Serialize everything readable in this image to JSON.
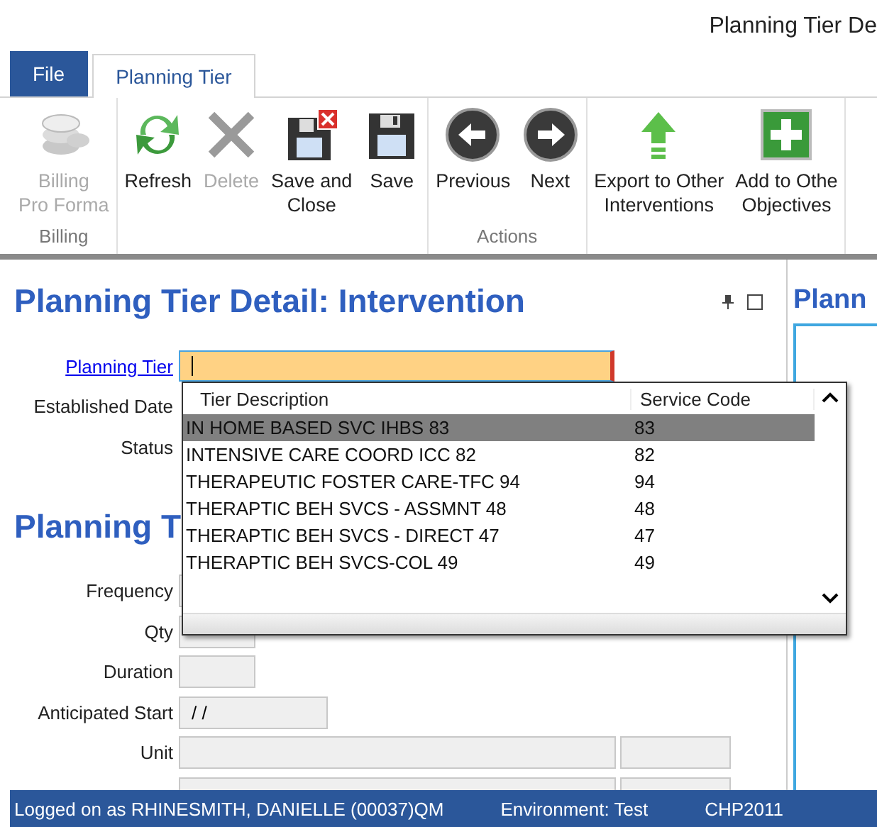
{
  "window": {
    "title": "Planning Tier De"
  },
  "tabs": [
    {
      "label": "File",
      "kind": "file",
      "selected": false
    },
    {
      "label": "Planning Tier",
      "kind": "tab",
      "selected": true
    }
  ],
  "ribbon": {
    "groups": [
      {
        "label": "Billing",
        "buttons": [
          {
            "lines": [
              "Billing",
              "Pro Forma"
            ],
            "kind": "coins",
            "disabled": true
          }
        ]
      },
      {
        "buttons": [
          {
            "lines": [
              "Refresh"
            ],
            "kind": "refresh",
            "disabled": false
          },
          {
            "lines": [
              "Delete"
            ],
            "kind": "delete",
            "disabled": true
          },
          {
            "lines": [
              "Save and",
              "Close"
            ],
            "kind": "save-close",
            "disabled": false
          },
          {
            "lines": [
              "Save"
            ],
            "kind": "save",
            "disabled": false
          }
        ]
      },
      {
        "label": "Actions",
        "buttons": [
          {
            "lines": [
              "Previous"
            ],
            "kind": "previous",
            "disabled": false
          },
          {
            "lines": [
              "Next"
            ],
            "kind": "next",
            "disabled": false
          }
        ]
      },
      {
        "buttons": [
          {
            "lines": [
              "Export to Other",
              "Interventions"
            ],
            "kind": "export",
            "disabled": false
          },
          {
            "lines": [
              "Add to Othe",
              "Objectives"
            ],
            "kind": "add",
            "disabled": false
          }
        ]
      }
    ]
  },
  "panel": {
    "title": "Planning Tier Detail: Intervention",
    "fields": [
      {
        "label": "Planning Tier",
        "kind": "lookup"
      },
      {
        "label": "Established Date",
        "kind": "label_only"
      },
      {
        "label": "Status",
        "kind": "label_only"
      }
    ],
    "section_title": "Planning T",
    "section_fields": [
      {
        "label": "Frequency",
        "kind": "wide"
      },
      {
        "label": "Qty",
        "kind": "small"
      },
      {
        "label": "Duration",
        "kind": "small"
      },
      {
        "label": "Anticipated Start",
        "kind": "date",
        "value": "/ /"
      },
      {
        "label": "Unit",
        "kind": "dual"
      },
      {
        "kind": "dual"
      }
    ]
  },
  "side_panel": {
    "title": "Plann"
  },
  "dropdown": {
    "columns": [
      "Tier Description",
      "Service Code"
    ],
    "rows": [
      {
        "description": "IN HOME BASED SVC IHBS 83",
        "code": "83",
        "selected": true
      },
      {
        "description": "INTENSIVE CARE COORD ICC 82",
        "code": "82",
        "selected": false
      },
      {
        "description": "THERAPEUTIC FOSTER CARE-TFC 94",
        "code": "94",
        "selected": false
      },
      {
        "description": "THERAPTIC BEH SVCS - ASSMNT 48",
        "code": "48",
        "selected": false
      },
      {
        "description": "THERAPTIC BEH SVCS - DIRECT 47",
        "code": "47",
        "selected": false
      },
      {
        "description": "THERAPTIC BEH SVCS-COL 49",
        "code": "49",
        "selected": false
      }
    ]
  },
  "status_bar": [
    "Logged on as RHINESMITH, DANIELLE (00037)QM",
    "Environment: Test",
    "CHP2011"
  ]
}
